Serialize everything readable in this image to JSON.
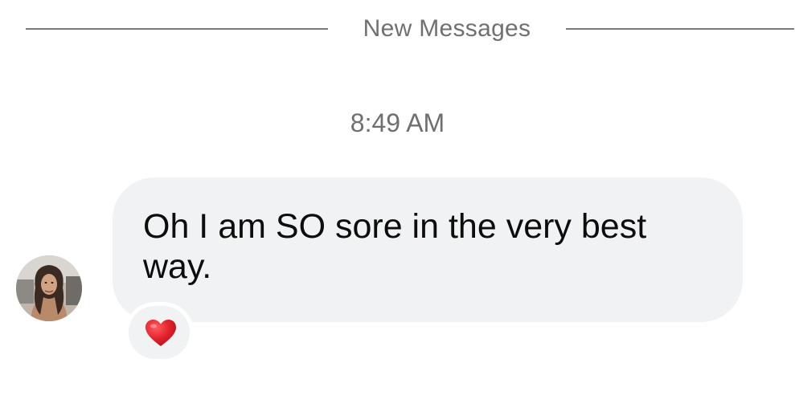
{
  "divider": {
    "label": "New Messages"
  },
  "timestamp": "8:49 AM",
  "message": {
    "text": "Oh I am SO sore in the very best way.",
    "reaction_icon": "red-heart-icon",
    "avatar_icon": "profile-photo-avatar"
  },
  "colors": {
    "bubble": "#f1f2f4",
    "divider_line": "#7a7a7a",
    "meta_text": "#707070",
    "message_text": "#0d0d0d",
    "heart": "#e0202a"
  }
}
